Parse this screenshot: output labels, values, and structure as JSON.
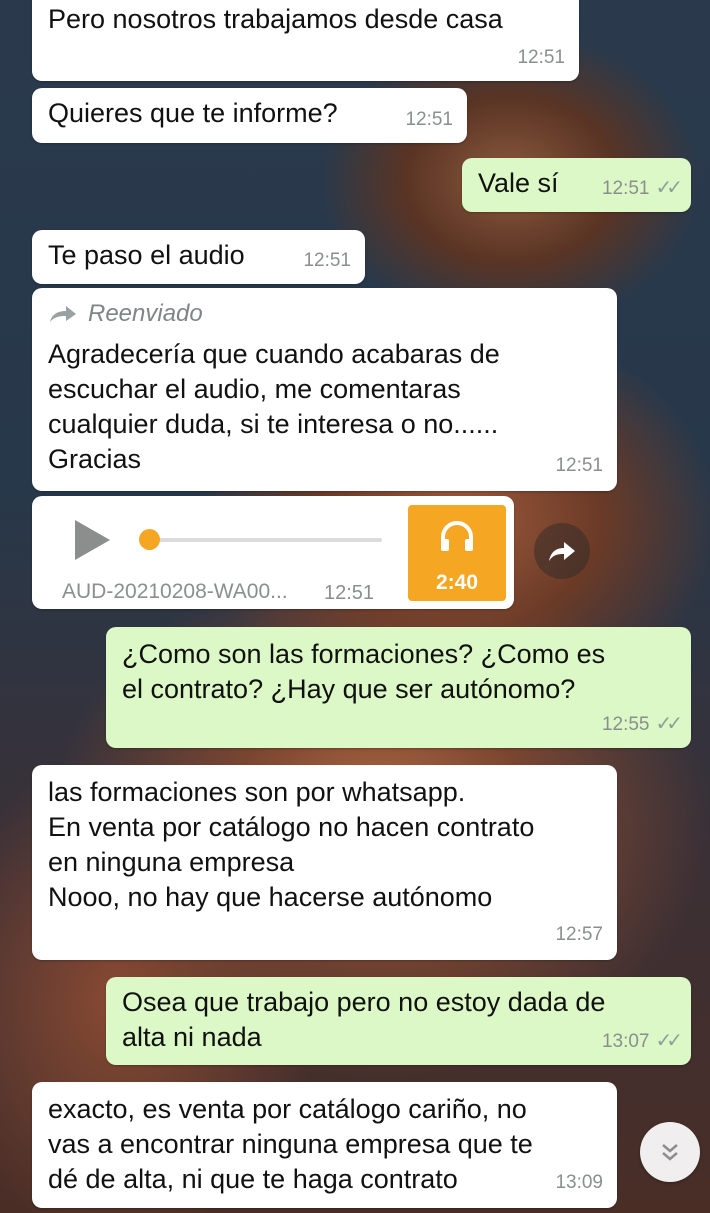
{
  "messages": [
    {
      "text": "Pero nosotros trabajamos desde casa",
      "time": "12:51"
    },
    {
      "text": "Quieres que te informe?",
      "time": "12:51"
    },
    {
      "text": "Vale sí",
      "time": "12:51",
      "ticks": "✓✓"
    },
    {
      "text": "Te paso el audio",
      "time": "12:51"
    },
    {
      "forward_label": "Reenviado",
      "text": "Agradecería que cuando acabaras de\nescuchar el audio, me comentaras\ncualquier duda, si te interesa o no......\nGracias",
      "time": "12:51"
    },
    {
      "text": "¿Como son las formaciones? ¿Como es\nel contrato? ¿Hay que ser autónomo?",
      "time": "12:55",
      "ticks": "✓✓"
    },
    {
      "text": "las formaciones son por whatsapp.\nEn venta por catálogo no hacen contrato\nen ninguna empresa\nNooo, no hay que hacerse autónomo",
      "time": "12:57"
    },
    {
      "text": "Osea que trabajo pero no estoy dada de\nalta ni nada",
      "time": "13:07",
      "ticks": "✓✓"
    },
    {
      "text": "exacto, es venta por catálogo cariño, no\nvas a encontrar ninguna empresa que te\ndé de alta, ni que te haga contrato",
      "time": "13:09"
    }
  ],
  "audio": {
    "filename": "AUD-20210208-WA00...",
    "time": "12:51",
    "duration": "2:40",
    "progress": 0.0,
    "accent_color": "#f5a623",
    "icons": {
      "play": "play-icon",
      "headphones": "headphones-icon",
      "share": "share-icon",
      "scroll": "scroll-down-icon"
    }
  }
}
